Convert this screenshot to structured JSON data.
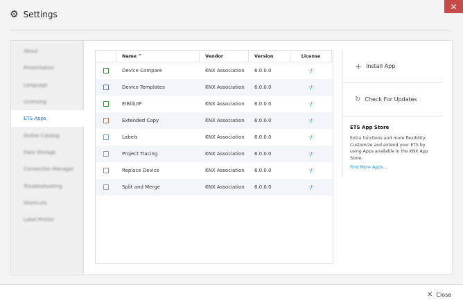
{
  "window": {
    "title": "Settings",
    "close_icon": "close-icon",
    "accent": "#1a73c7",
    "close_color": "#c94a4a"
  },
  "sidebar": {
    "items": [
      {
        "label": "About"
      },
      {
        "label": "Presentation"
      },
      {
        "label": "Language"
      },
      {
        "label": "Licensing"
      },
      {
        "label": "ETS Apps",
        "active": true
      },
      {
        "label": "Online Catalog"
      },
      {
        "label": "Data Storage"
      },
      {
        "label": "Connection Manager"
      },
      {
        "label": "Troubleshooting"
      },
      {
        "label": "Shortcuts"
      },
      {
        "label": "Label Printer"
      }
    ]
  },
  "table": {
    "headers": {
      "name": "Name ^",
      "vendor": "Vendor",
      "version": "Version",
      "license": "License"
    },
    "rows": [
      {
        "name": "Device Compare",
        "vendor": "KNX Association",
        "version": "6.0.0.0",
        "icon": "device-compare-icon"
      },
      {
        "name": "Device Templates",
        "vendor": "KNX Association",
        "version": "6.0.0.0",
        "icon": "device-templates-icon"
      },
      {
        "name": "EIBlib/IP",
        "vendor": "KNX Association",
        "version": "6.0.0.0",
        "icon": "network-icon"
      },
      {
        "name": "Extended Copy",
        "vendor": "KNX Association",
        "version": "6.0.0.0",
        "icon": "extended-copy-icon"
      },
      {
        "name": "Labels",
        "vendor": "KNX Association",
        "version": "6.0.0.0",
        "icon": "label-tag-icon"
      },
      {
        "name": "Project Tracing",
        "vendor": "KNX Association",
        "version": "6.0.0.0",
        "icon": "document-icon"
      },
      {
        "name": "Replace Device",
        "vendor": "KNX Association",
        "version": "6.0.0.0",
        "icon": "replace-device-icon"
      },
      {
        "name": "Split and Merge",
        "vendor": "KNX Association",
        "version": "6.0.0.0",
        "icon": "split-merge-icon"
      }
    ]
  },
  "actions": {
    "install": "Install App",
    "update": "Check For Updates"
  },
  "store": {
    "title": "ETS App Store",
    "text": "Extra functions and more flexibility. Customize and extend your ETS by using Apps available in the KNX App Store.",
    "link": "Find More Apps..."
  },
  "footer": {
    "close": "Close"
  }
}
